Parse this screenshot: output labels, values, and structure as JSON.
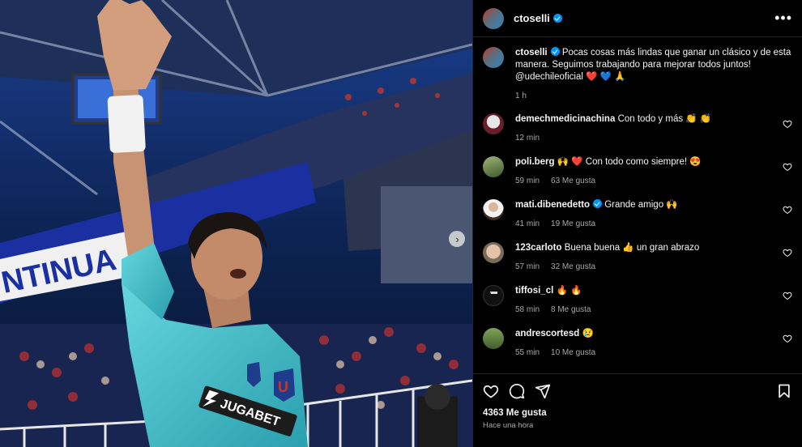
{
  "post": {
    "username": "ctoselli",
    "caption_text": "Pocas cosas más lindas que ganar un clásico y de esta manera. Seguimos trabajando para mejorar todos juntos! @udechileoficial ❤️ 💙 🙏",
    "caption_time": "1 h",
    "likes": "4363 Me gusta",
    "posted": "Hace una hora",
    "jersey_sponsor": "JUGABET",
    "banner_text": "NTINUA",
    "next_icon": "›"
  },
  "comments": [
    {
      "user": "demechmedicinachina",
      "verified": false,
      "text": "Con todo y más 👏 👏",
      "time": "12 min",
      "likes": ""
    },
    {
      "user": "poli.berg",
      "verified": false,
      "text": "🙌 ❤️  Con todo como siempre! 😍",
      "time": "59 min",
      "likes": "63 Me gusta"
    },
    {
      "user": "mati.dibenedetto",
      "verified": true,
      "text": "Grande amigo 🙌",
      "time": "41 min",
      "likes": "19 Me gusta"
    },
    {
      "user": "123carloto",
      "verified": false,
      "text": "Buena buena 👍 un gran abrazo",
      "time": "57 min",
      "likes": "32 Me gusta"
    },
    {
      "user": "tiffosi_cl",
      "verified": false,
      "text": "🔥 🔥",
      "time": "58 min",
      "likes": "8 Me gusta"
    },
    {
      "user": "andrescortesd",
      "verified": false,
      "text": "😢",
      "time": "55 min",
      "likes": "10 Me gusta"
    }
  ],
  "colors": {
    "verified": "#0095f6",
    "secondary_text": "#a8a8a8",
    "jersey": "#3fc1c9"
  }
}
